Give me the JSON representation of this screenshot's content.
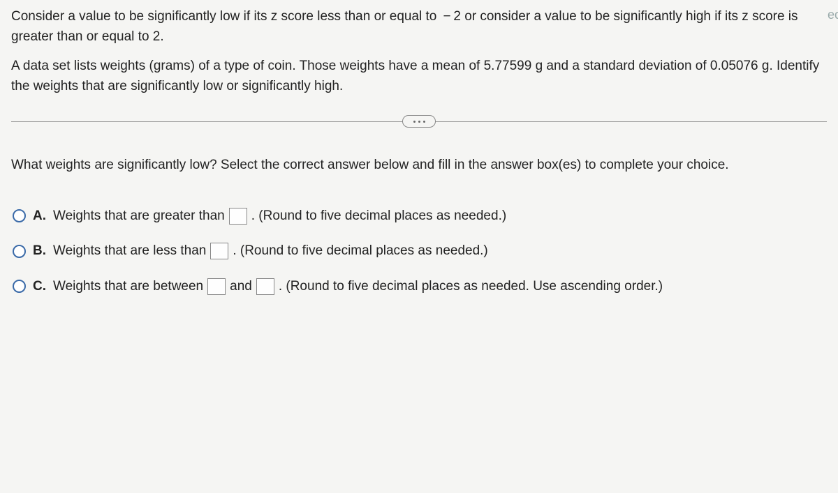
{
  "intro": "Consider a value to be significantly low if its z score less than or equal to  − 2 or consider a value to be significantly high if its z score is greater than or equal to 2.",
  "context": "A data set lists weights (grams) of a type of coin. Those weights have a mean of 5.77599 g and a standard deviation of 0.05076 g. Identify the weights that are significantly low or significantly high.",
  "question": "What weights are significantly low? Select the correct answer below and fill in the answer box(es) to complete your choice.",
  "choices": {
    "A": {
      "letter": "A.",
      "pre": "Weights that are greater than",
      "post": ". (Round to five decimal places as needed.)"
    },
    "B": {
      "letter": "B.",
      "pre": "Weights that are less than",
      "post": ". (Round to five decimal places as needed.)"
    },
    "C": {
      "letter": "C.",
      "pre": "Weights that are between",
      "mid": "and",
      "post": ". (Round to five decimal places as needed. Use ascending order.)"
    }
  },
  "edge": "ec"
}
